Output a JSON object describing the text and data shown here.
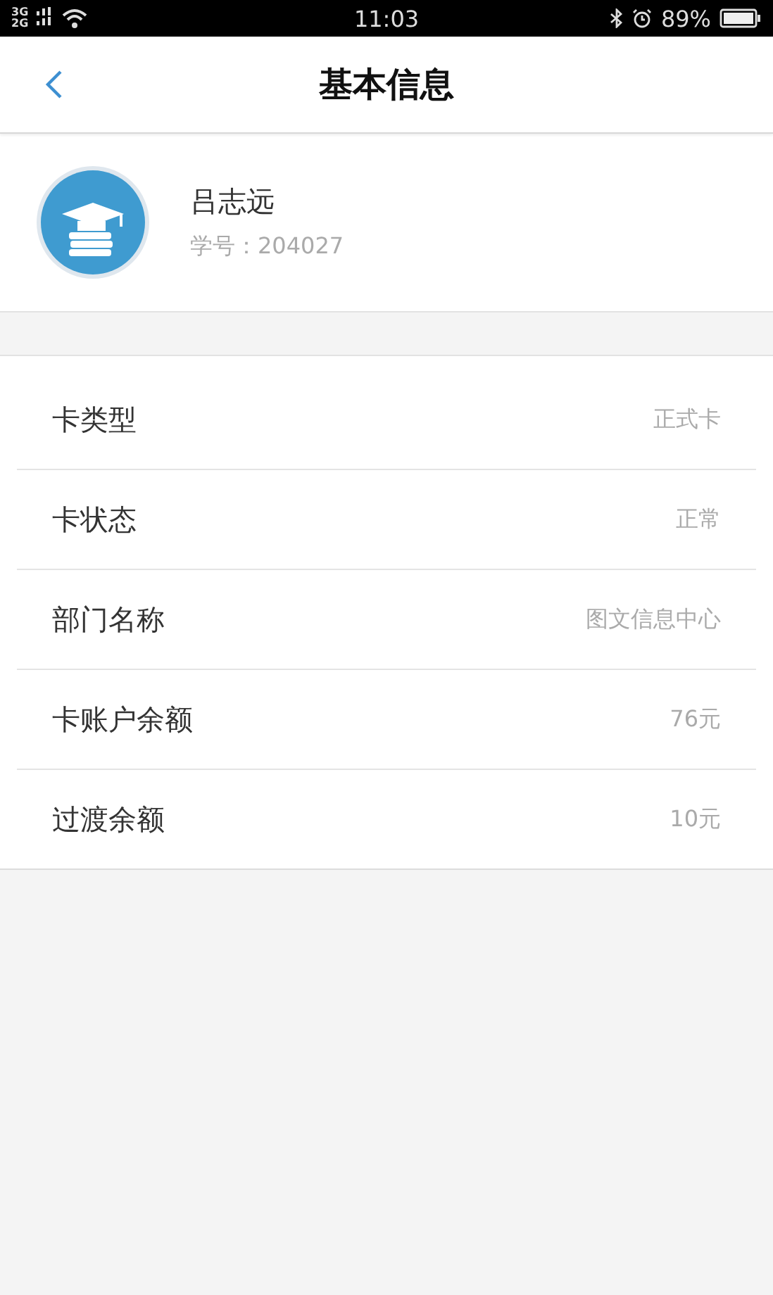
{
  "status_bar": {
    "network_top": "3G",
    "network_bottom": "2G",
    "time": "11:03",
    "battery": "89%"
  },
  "header": {
    "title": "基本信息"
  },
  "profile": {
    "name": "吕志远",
    "student_id": "学号：204027"
  },
  "info_rows": [
    {
      "label": "卡类型",
      "value": "正式卡"
    },
    {
      "label": "卡状态",
      "value": "正常"
    },
    {
      "label": "部门名称",
      "value": "图文信息中心"
    },
    {
      "label": "卡账户余额",
      "value": "76元"
    },
    {
      "label": "过渡余额",
      "value": "10元"
    }
  ]
}
